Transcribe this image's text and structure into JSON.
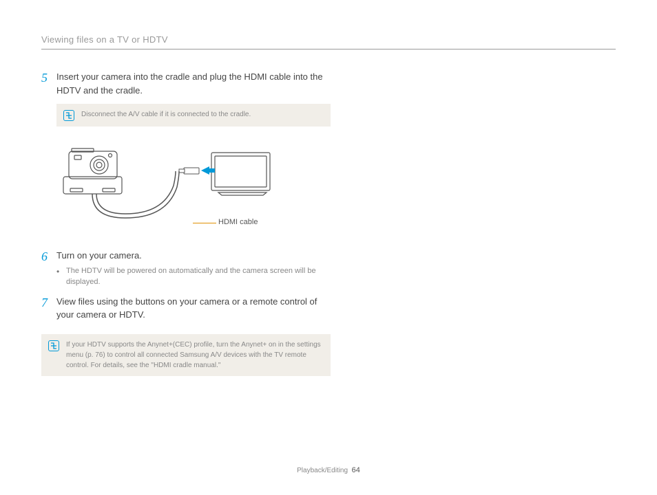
{
  "header": {
    "title": "Viewing files on a TV or HDTV"
  },
  "steps": {
    "s5": {
      "num": "5",
      "text": "Insert your camera into the cradle and plug the HDMI cable into the HDTV and the cradle.",
      "note": "Disconnect the A/V cable if it is connected to the cradle."
    },
    "s6": {
      "num": "6",
      "text": "Turn on your camera.",
      "bullet": "The HDTV will be powered on automatically and the camera screen will be displayed."
    },
    "s7": {
      "num": "7",
      "text": "View files using the buttons on your camera or a remote control of your camera or HDTV."
    }
  },
  "diagram": {
    "cable_label": "HDMI cable"
  },
  "bottom_note": "If your HDTV supports the Anynet+(CEC) profile, turn the Anynet+ on in the settings menu (p. 76) to control all connected Samsung A/V devices with the TV remote control. For details, see the \"HDMI cradle manual.\"",
  "footer": {
    "section": "Playback/Editing",
    "page": "64"
  }
}
